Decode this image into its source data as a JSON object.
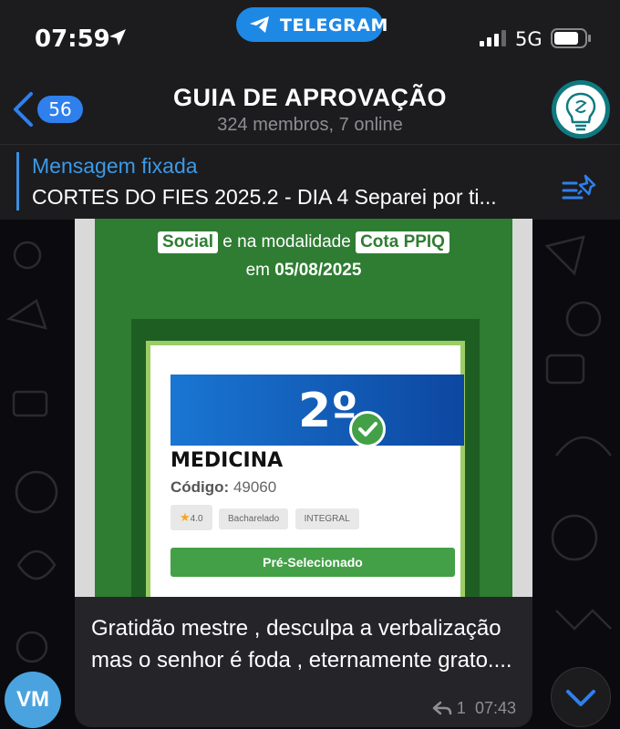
{
  "status_bar": {
    "time": "07:59",
    "app_pill": "TELEGRAM",
    "network": "5G",
    "icons": [
      "location-arrow-icon",
      "telegram-plane-icon",
      "signal-bars-icon",
      "battery-icon"
    ]
  },
  "header": {
    "back_badge": "56",
    "title": "GUIA DE APROVAÇÃO",
    "subtitle": "324 membros, 7 online"
  },
  "pinned": {
    "title": "Mensagem fixada",
    "text": "CORTES DO FIES 2025.2 - DIA 4 Separei por ti..."
  },
  "message": {
    "image": {
      "tag_social": "Social",
      "line1_middle": "e na modalidade",
      "tag_cota": "Cota PPIQ",
      "line2_prefix": "em",
      "date": "05/08/2025",
      "rank": "2º",
      "course": "MEDICINA",
      "code_label": "Código:",
      "code_value": "49060",
      "chip_rating": "4.0",
      "chip_degree": "Bacharelado",
      "chip_shift": "INTEGRAL",
      "button": "Pré-Selecionado"
    },
    "text": "Gratidão mestre , desculpa a verbalização mas o senhor é foda , eternamente grato....",
    "reply_count": "1",
    "time": "07:43"
  },
  "sender_initials": "VM",
  "colors": {
    "accent": "#2f80ed",
    "pinned_title": "#3a9ae8",
    "image_green": "#2e7d32",
    "avatar_vm": "#4aa3df"
  }
}
